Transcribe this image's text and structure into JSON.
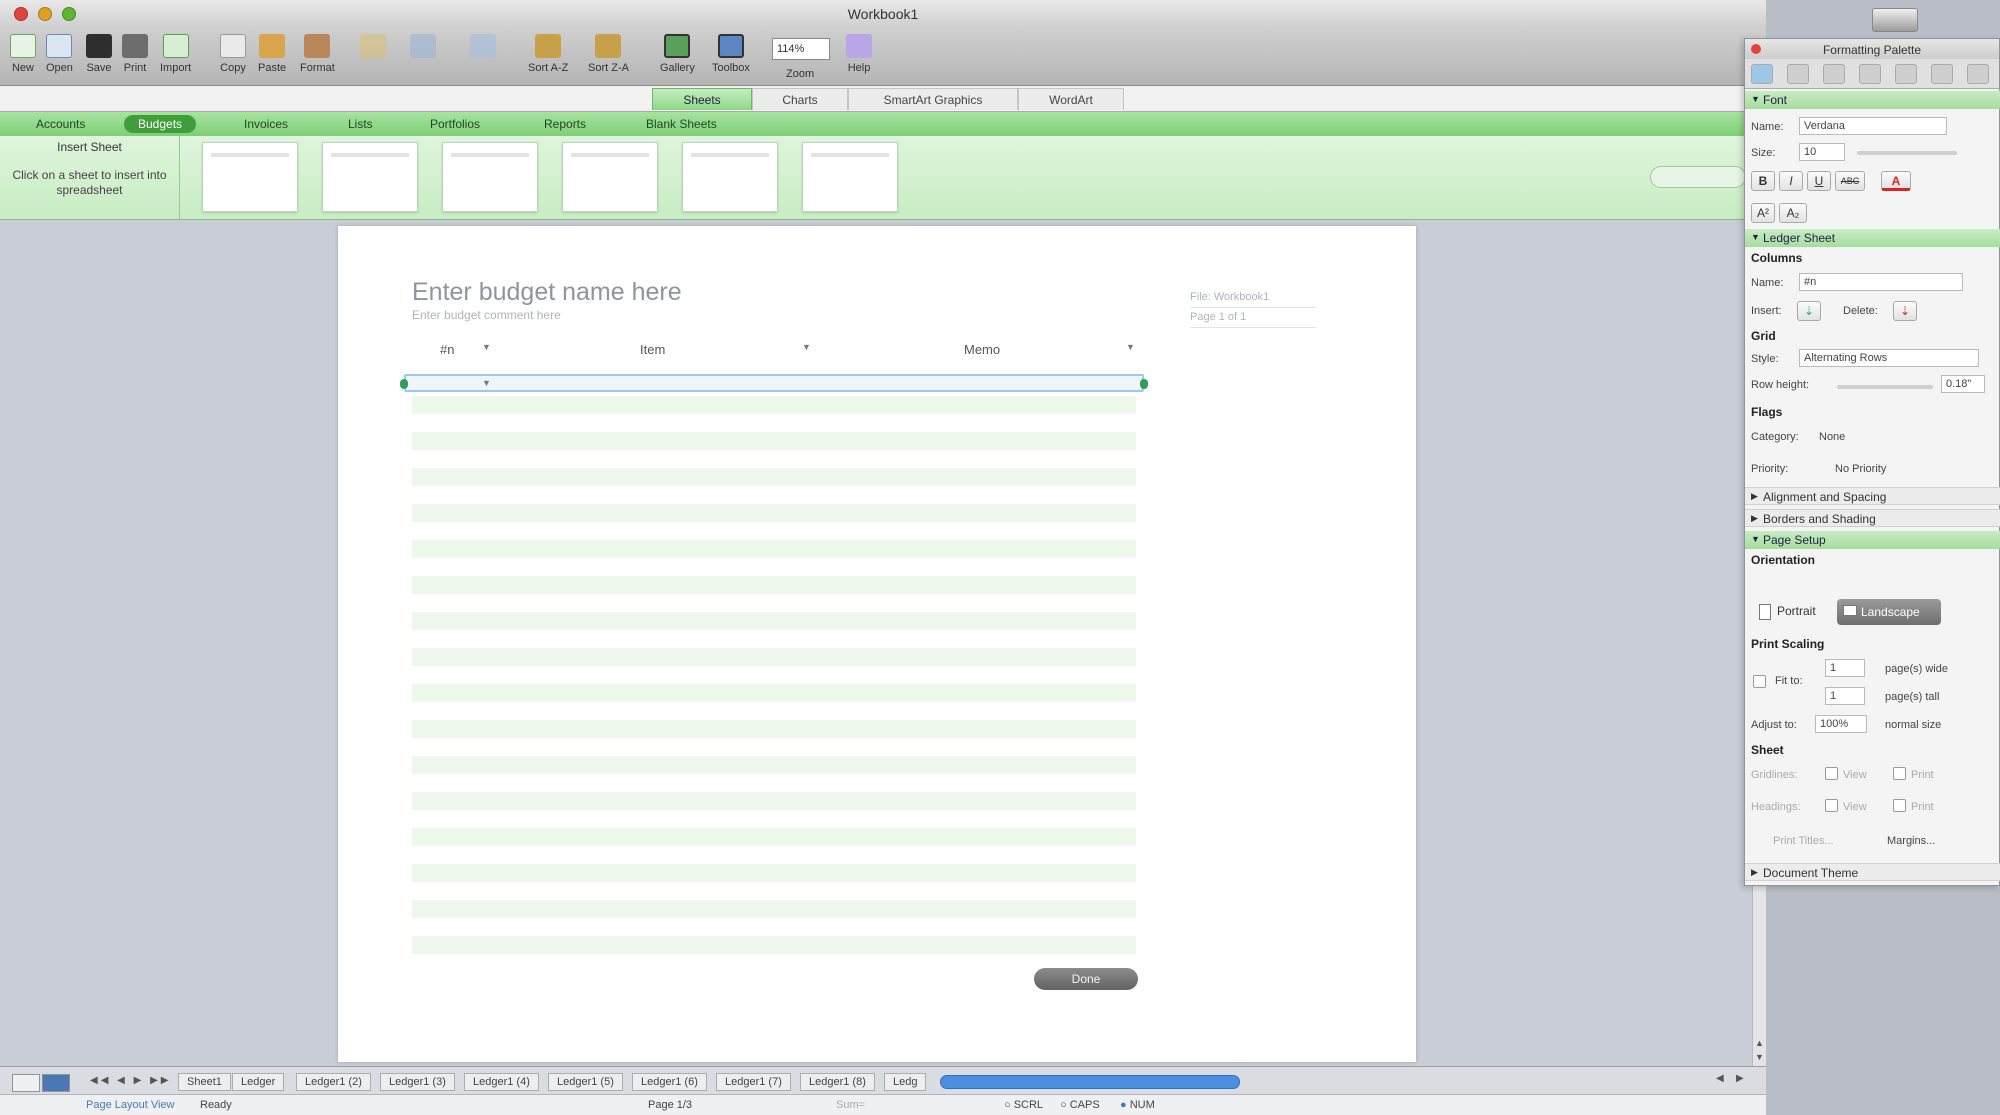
{
  "window": {
    "title": "Workbook1"
  },
  "toolbar": {
    "new": "New",
    "open": "Open",
    "save": "Save",
    "print": "Print",
    "import": "Import",
    "copy": "Copy",
    "paste": "Paste",
    "format": "Format",
    "sort_az": "Sort A-Z",
    "sort_za": "Sort Z-A",
    "gallery": "Gallery",
    "toolbox": "Toolbox",
    "zoom": "Zoom",
    "zoom_value": "114%",
    "help": "Help"
  },
  "ribbon": {
    "tabs": [
      "Sheets",
      "Charts",
      "SmartArt Graphics",
      "WordArt"
    ],
    "active_tab": "Sheets"
  },
  "gallery": {
    "tabs": [
      "Accounts",
      "Budgets",
      "Invoices",
      "Lists",
      "Portfolios",
      "Reports",
      "Blank Sheets"
    ],
    "active_tab": "Budgets",
    "insert_title": "Insert Sheet",
    "insert_hint": "Click on a sheet to insert into spreadsheet",
    "thumbnail_count": 6
  },
  "document": {
    "budget_title": "Enter budget name here",
    "budget_comment": "Enter budget comment here",
    "file_label": "File: Workbook1",
    "page_label": "Page 1 of 1",
    "columns": [
      "#n",
      "Item",
      "Memo"
    ],
    "done_button": "Done"
  },
  "sheet_tabs": {
    "tabs": [
      "Sheet1",
      "Ledger",
      "Ledger1 (2)",
      "Ledger1 (3)",
      "Ledger1 (4)",
      "Ledger1 (5)",
      "Ledger1 (6)",
      "Ledger1 (7)",
      "Ledger1 (8)",
      "Ledg"
    ]
  },
  "status_bar": {
    "view": "Page Layout View",
    "state": "Ready",
    "page": "Page 1/3",
    "sum": "Sum=",
    "scrl": "SCRL",
    "caps": "CAPS",
    "num": "NUM"
  },
  "palette": {
    "title": "Formatting Palette",
    "sections": {
      "font": "Font",
      "ledger_sheet": "Ledger Sheet",
      "alignment": "Alignment and Spacing",
      "borders": "Borders and Shading",
      "page_setup": "Page Setup",
      "document_theme": "Document Theme"
    },
    "font": {
      "name_label": "Name:",
      "name_value": "Verdana",
      "size_label": "Size:",
      "size_value": "10",
      "bold": "B",
      "italic": "I",
      "underline": "U",
      "strike": "ABC",
      "color_glyph": "A",
      "super": "A²",
      "sub": "A₂"
    },
    "ledger": {
      "columns_heading": "Columns",
      "col_name_label": "Name:",
      "col_name_value": "#n",
      "insert_label": "Insert:",
      "delete_label": "Delete:",
      "grid_heading": "Grid",
      "style_label": "Style:",
      "style_value": "Alternating Rows",
      "row_height_label": "Row height:",
      "row_height_value": "0.18\"",
      "flags_heading": "Flags",
      "category_label": "Category:",
      "category_value": "None",
      "priority_label": "Priority:",
      "priority_value": "No Priority"
    },
    "page_setup": {
      "orientation_heading": "Orientation",
      "portrait": "Portrait",
      "landscape": "Landscape",
      "print_scaling_heading": "Print Scaling",
      "fit_to": "Fit to:",
      "pages_wide_value": "1",
      "pages_wide": "page(s) wide",
      "pages_tall_value": "1",
      "pages_tall": "page(s) tall",
      "adjust_to": "Adjust to:",
      "adjust_value": "100%",
      "normal_size": "normal size",
      "sheet_heading": "Sheet",
      "gridlines": "Gridlines:",
      "headings": "Headings:",
      "view": "View",
      "print": "Print",
      "print_titles": "Print Titles...",
      "margins": "Margins..."
    }
  },
  "colors": {
    "accent_green": "#7fce77",
    "selection_blue": "#9ec9ee",
    "scroll_blue": "#4d8ee0"
  }
}
